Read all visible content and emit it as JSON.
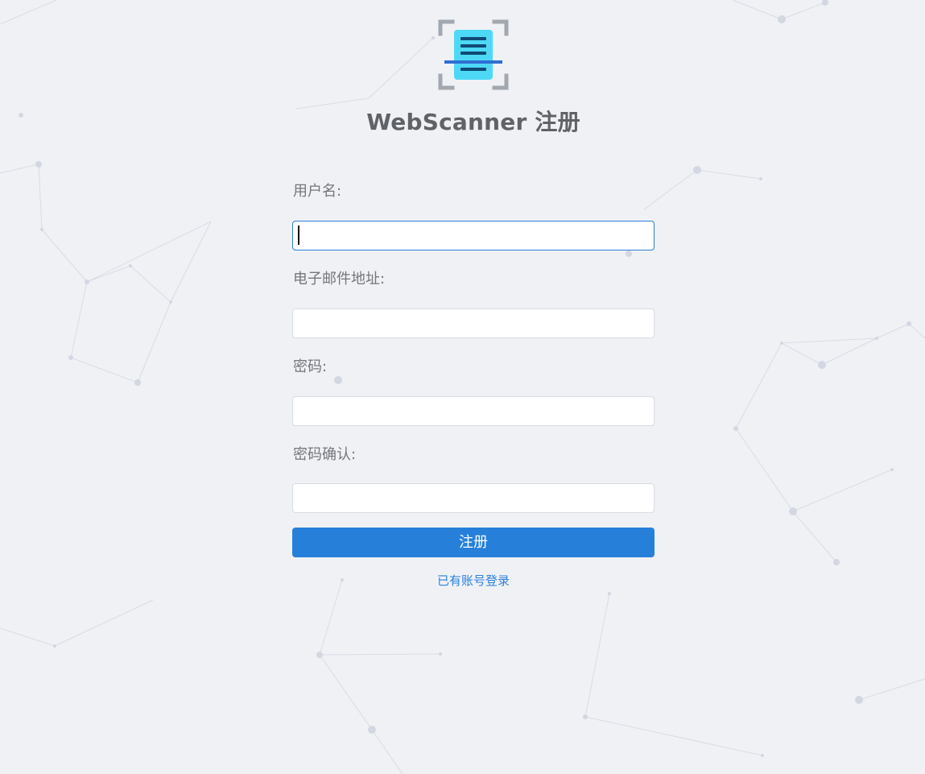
{
  "app": {
    "title": "WebScanner 注册",
    "logo_icon": "document-scanner-icon"
  },
  "form": {
    "username": {
      "label": "用户名:",
      "value": "",
      "placeholder": ""
    },
    "email": {
      "label": "电子邮件地址:",
      "value": "",
      "placeholder": ""
    },
    "password": {
      "label": "密码:",
      "value": "",
      "placeholder": ""
    },
    "password_confirm": {
      "label": "密码确认:",
      "value": "",
      "placeholder": ""
    },
    "submit_label": "注册",
    "login_link_label": "已有账号登录"
  },
  "colors": {
    "background": "#f0f1f5",
    "accent": "#2680da",
    "title_text": "#5f6266",
    "label_text": "#73767b",
    "logo_document": "#4dd9f6",
    "logo_frame": "#a2a8b0"
  }
}
